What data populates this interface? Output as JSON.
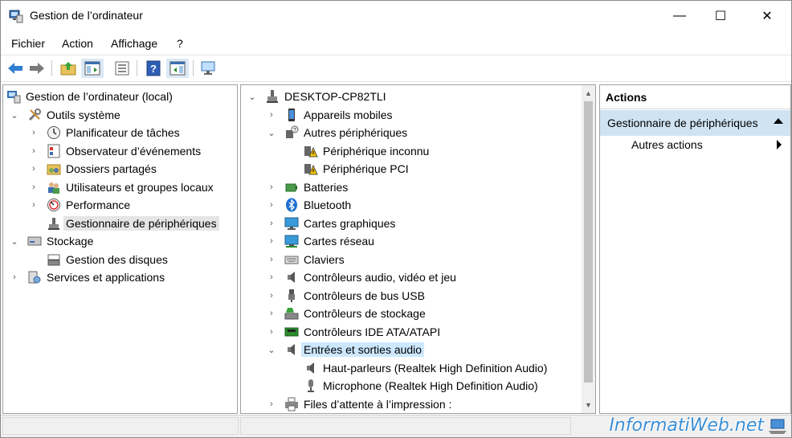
{
  "window": {
    "title": "Gestion de l’ordinateur",
    "controls": {
      "minimize": "—",
      "maximize": "☐",
      "close": "✕"
    }
  },
  "menu": [
    "Fichier",
    "Action",
    "Affichage",
    "?"
  ],
  "toolbar": {
    "buttons": [
      "back-arrow-icon",
      "forward-arrow-icon",
      "up-folder-icon",
      "show-hide-tree-icon",
      "properties-icon",
      "help-icon",
      "show-action-pane-icon",
      "monitor-icon"
    ]
  },
  "left_tree": {
    "root": "Gestion de l’ordinateur (local)",
    "outils": "Outils système",
    "planificateur": "Planificateur de tâches",
    "observateur": "Observateur d’événements",
    "dossiers": "Dossiers partagés",
    "utilisateurs": "Utilisateurs et groupes locaux",
    "performance": "Performance",
    "gestionnaire": "Gestionnaire de périphériques",
    "stockage": "Stockage",
    "disques": "Gestion des disques",
    "services": "Services et applications"
  },
  "device_tree": {
    "computer": "DESKTOP-CP82TLI",
    "appareils_mobiles": "Appareils mobiles",
    "autres_peripheriques": "Autres périphériques",
    "peripherique_inconnu": "Périphérique inconnu",
    "peripherique_pci": "Périphérique PCI",
    "batteries": "Batteries",
    "bluetooth": "Bluetooth",
    "cartes_graphiques": "Cartes graphiques",
    "cartes_reseau": "Cartes réseau",
    "claviers": "Claviers",
    "controleurs_audio": "Contrôleurs audio, vidéo et jeu",
    "controleurs_usb": "Contrôleurs de bus USB",
    "controleurs_stockage": "Contrôleurs de stockage",
    "controleurs_ide": "Contrôleurs IDE ATA/ATAPI",
    "entrees_sorties_audio": "Entrées et sorties audio",
    "haut_parleurs": "Haut-parleurs (Realtek High Definition Audio)",
    "microphone": "Microphone (Realtek High Definition Audio)",
    "files_attente": "Files d’attente à l’impression :"
  },
  "actions": {
    "header": "Actions",
    "section": "Gestionnaire de périphériques",
    "sub": "Autres actions"
  },
  "watermark": "InformatiWeb.net",
  "colors": {
    "selection_gray": "#e5e5e5",
    "selection_blue": "#cce8ff",
    "actions_section": "#cfe3f3",
    "watermark": "#3b8fd6"
  }
}
